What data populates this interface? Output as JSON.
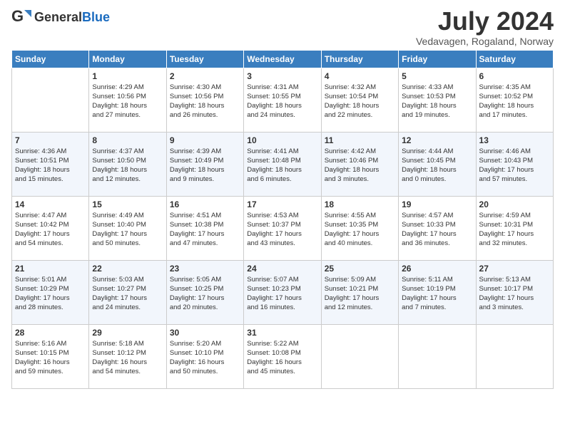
{
  "logo": {
    "text_general": "General",
    "text_blue": "Blue"
  },
  "title": "July 2024",
  "subtitle": "Vedavagen, Rogaland, Norway",
  "days_of_week": [
    "Sunday",
    "Monday",
    "Tuesday",
    "Wednesday",
    "Thursday",
    "Friday",
    "Saturday"
  ],
  "weeks": [
    [
      {
        "day": "",
        "info": ""
      },
      {
        "day": "1",
        "info": "Sunrise: 4:29 AM\nSunset: 10:56 PM\nDaylight: 18 hours\nand 27 minutes."
      },
      {
        "day": "2",
        "info": "Sunrise: 4:30 AM\nSunset: 10:56 PM\nDaylight: 18 hours\nand 26 minutes."
      },
      {
        "day": "3",
        "info": "Sunrise: 4:31 AM\nSunset: 10:55 PM\nDaylight: 18 hours\nand 24 minutes."
      },
      {
        "day": "4",
        "info": "Sunrise: 4:32 AM\nSunset: 10:54 PM\nDaylight: 18 hours\nand 22 minutes."
      },
      {
        "day": "5",
        "info": "Sunrise: 4:33 AM\nSunset: 10:53 PM\nDaylight: 18 hours\nand 19 minutes."
      },
      {
        "day": "6",
        "info": "Sunrise: 4:35 AM\nSunset: 10:52 PM\nDaylight: 18 hours\nand 17 minutes."
      }
    ],
    [
      {
        "day": "7",
        "info": "Sunrise: 4:36 AM\nSunset: 10:51 PM\nDaylight: 18 hours\nand 15 minutes."
      },
      {
        "day": "8",
        "info": "Sunrise: 4:37 AM\nSunset: 10:50 PM\nDaylight: 18 hours\nand 12 minutes."
      },
      {
        "day": "9",
        "info": "Sunrise: 4:39 AM\nSunset: 10:49 PM\nDaylight: 18 hours\nand 9 minutes."
      },
      {
        "day": "10",
        "info": "Sunrise: 4:41 AM\nSunset: 10:48 PM\nDaylight: 18 hours\nand 6 minutes."
      },
      {
        "day": "11",
        "info": "Sunrise: 4:42 AM\nSunset: 10:46 PM\nDaylight: 18 hours\nand 3 minutes."
      },
      {
        "day": "12",
        "info": "Sunrise: 4:44 AM\nSunset: 10:45 PM\nDaylight: 18 hours\nand 0 minutes."
      },
      {
        "day": "13",
        "info": "Sunrise: 4:46 AM\nSunset: 10:43 PM\nDaylight: 17 hours\nand 57 minutes."
      }
    ],
    [
      {
        "day": "14",
        "info": "Sunrise: 4:47 AM\nSunset: 10:42 PM\nDaylight: 17 hours\nand 54 minutes."
      },
      {
        "day": "15",
        "info": "Sunrise: 4:49 AM\nSunset: 10:40 PM\nDaylight: 17 hours\nand 50 minutes."
      },
      {
        "day": "16",
        "info": "Sunrise: 4:51 AM\nSunset: 10:38 PM\nDaylight: 17 hours\nand 47 minutes."
      },
      {
        "day": "17",
        "info": "Sunrise: 4:53 AM\nSunset: 10:37 PM\nDaylight: 17 hours\nand 43 minutes."
      },
      {
        "day": "18",
        "info": "Sunrise: 4:55 AM\nSunset: 10:35 PM\nDaylight: 17 hours\nand 40 minutes."
      },
      {
        "day": "19",
        "info": "Sunrise: 4:57 AM\nSunset: 10:33 PM\nDaylight: 17 hours\nand 36 minutes."
      },
      {
        "day": "20",
        "info": "Sunrise: 4:59 AM\nSunset: 10:31 PM\nDaylight: 17 hours\nand 32 minutes."
      }
    ],
    [
      {
        "day": "21",
        "info": "Sunrise: 5:01 AM\nSunset: 10:29 PM\nDaylight: 17 hours\nand 28 minutes."
      },
      {
        "day": "22",
        "info": "Sunrise: 5:03 AM\nSunset: 10:27 PM\nDaylight: 17 hours\nand 24 minutes."
      },
      {
        "day": "23",
        "info": "Sunrise: 5:05 AM\nSunset: 10:25 PM\nDaylight: 17 hours\nand 20 minutes."
      },
      {
        "day": "24",
        "info": "Sunrise: 5:07 AM\nSunset: 10:23 PM\nDaylight: 17 hours\nand 16 minutes."
      },
      {
        "day": "25",
        "info": "Sunrise: 5:09 AM\nSunset: 10:21 PM\nDaylight: 17 hours\nand 12 minutes."
      },
      {
        "day": "26",
        "info": "Sunrise: 5:11 AM\nSunset: 10:19 PM\nDaylight: 17 hours\nand 7 minutes."
      },
      {
        "day": "27",
        "info": "Sunrise: 5:13 AM\nSunset: 10:17 PM\nDaylight: 17 hours\nand 3 minutes."
      }
    ],
    [
      {
        "day": "28",
        "info": "Sunrise: 5:16 AM\nSunset: 10:15 PM\nDaylight: 16 hours\nand 59 minutes."
      },
      {
        "day": "29",
        "info": "Sunrise: 5:18 AM\nSunset: 10:12 PM\nDaylight: 16 hours\nand 54 minutes."
      },
      {
        "day": "30",
        "info": "Sunrise: 5:20 AM\nSunset: 10:10 PM\nDaylight: 16 hours\nand 50 minutes."
      },
      {
        "day": "31",
        "info": "Sunrise: 5:22 AM\nSunset: 10:08 PM\nDaylight: 16 hours\nand 45 minutes."
      },
      {
        "day": "",
        "info": ""
      },
      {
        "day": "",
        "info": ""
      },
      {
        "day": "",
        "info": ""
      }
    ]
  ]
}
